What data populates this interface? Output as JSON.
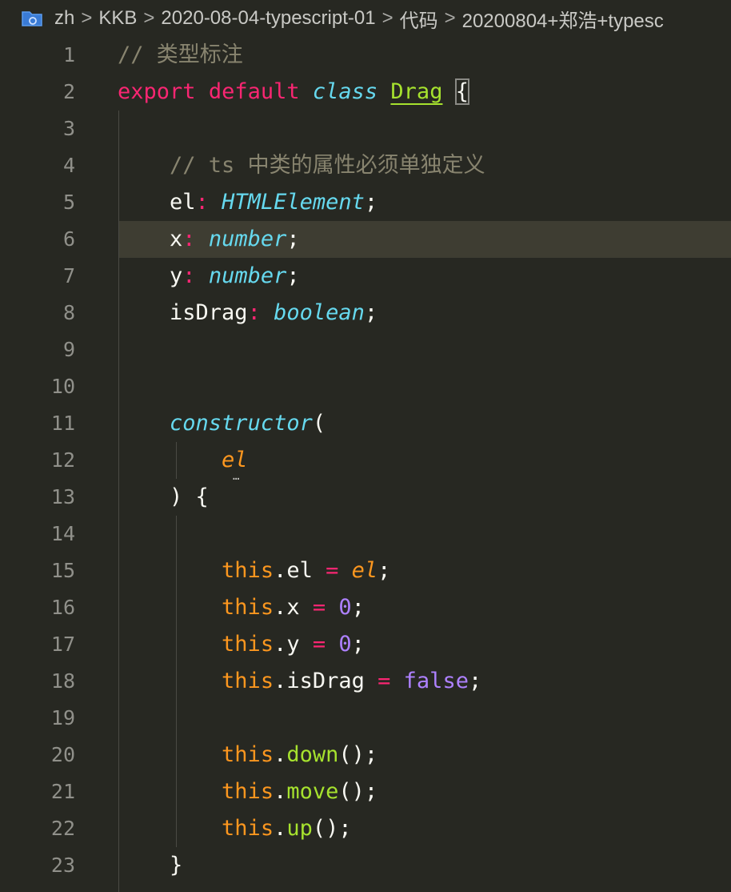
{
  "breadcrumb": {
    "segments": [
      "zh",
      "KKB",
      "2020-08-04-typescript-01",
      "代码",
      "20200804+郑浩+typesc"
    ],
    "separator": ">"
  },
  "colors": {
    "background": "#272822",
    "current_line": "#3e3d32",
    "line_number": "#90908a",
    "comment": "#88846f",
    "keyword": "#f92672",
    "type": "#66d9ef",
    "this": "#fd971f",
    "number": "#ae81ff",
    "function": "#a6e22e"
  },
  "editor": {
    "current_line_number": 6,
    "lines": [
      {
        "n": "1",
        "tokens": [
          {
            "t": "// 类型标注",
            "c": "comment"
          }
        ]
      },
      {
        "n": "2",
        "tokens": [
          {
            "t": "export",
            "c": "kw"
          },
          {
            "t": " ",
            "c": "punc"
          },
          {
            "t": "default",
            "c": "kw"
          },
          {
            "t": " ",
            "c": "punc"
          },
          {
            "t": "class",
            "c": "storage"
          },
          {
            "t": " ",
            "c": "punc"
          },
          {
            "t": "Drag",
            "c": "class"
          },
          {
            "t": " ",
            "c": "punc"
          },
          {
            "t": "{",
            "c": "brace"
          }
        ]
      },
      {
        "n": "3",
        "tokens": []
      },
      {
        "n": "4",
        "tokens": [
          {
            "t": "    ",
            "c": "punc"
          },
          {
            "t": "// ts 中类的属性必须单独定义",
            "c": "comment"
          }
        ]
      },
      {
        "n": "5",
        "tokens": [
          {
            "t": "    ",
            "c": "punc"
          },
          {
            "t": "el",
            "c": "prop"
          },
          {
            "t": ":",
            "c": "op"
          },
          {
            "t": " ",
            "c": "punc"
          },
          {
            "t": "HTMLElement",
            "c": "type"
          },
          {
            "t": ";",
            "c": "punc"
          }
        ]
      },
      {
        "n": "6",
        "tokens": [
          {
            "t": "    ",
            "c": "punc"
          },
          {
            "t": "x",
            "c": "prop"
          },
          {
            "t": ":",
            "c": "op"
          },
          {
            "t": " ",
            "c": "punc"
          },
          {
            "t": "number",
            "c": "type"
          },
          {
            "t": ";",
            "c": "punc"
          }
        ]
      },
      {
        "n": "7",
        "tokens": [
          {
            "t": "    ",
            "c": "punc"
          },
          {
            "t": "y",
            "c": "prop"
          },
          {
            "t": ":",
            "c": "op"
          },
          {
            "t": " ",
            "c": "punc"
          },
          {
            "t": "number",
            "c": "type"
          },
          {
            "t": ";",
            "c": "punc"
          }
        ]
      },
      {
        "n": "8",
        "tokens": [
          {
            "t": "    ",
            "c": "punc"
          },
          {
            "t": "isDrag",
            "c": "prop"
          },
          {
            "t": ":",
            "c": "op"
          },
          {
            "t": " ",
            "c": "punc"
          },
          {
            "t": "boolean",
            "c": "type"
          },
          {
            "t": ";",
            "c": "punc"
          }
        ]
      },
      {
        "n": "9",
        "tokens": []
      },
      {
        "n": "10",
        "tokens": []
      },
      {
        "n": "11",
        "tokens": [
          {
            "t": "    ",
            "c": "punc"
          },
          {
            "t": "constructor",
            "c": "ctor"
          },
          {
            "t": "(",
            "c": "punc"
          }
        ]
      },
      {
        "n": "12",
        "tokens": [
          {
            "t": "        ",
            "c": "punc"
          },
          {
            "t": "el",
            "c": "param"
          }
        ]
      },
      {
        "n": "13",
        "tokens": [
          {
            "t": "    ",
            "c": "punc"
          },
          {
            "t": ") {",
            "c": "punc"
          }
        ]
      },
      {
        "n": "14",
        "tokens": []
      },
      {
        "n": "15",
        "tokens": [
          {
            "t": "        ",
            "c": "punc"
          },
          {
            "t": "this",
            "c": "this"
          },
          {
            "t": ".el",
            "c": "prop"
          },
          {
            "t": " ",
            "c": "punc"
          },
          {
            "t": "=",
            "c": "op"
          },
          {
            "t": " ",
            "c": "punc"
          },
          {
            "t": "el",
            "c": "param"
          },
          {
            "t": ";",
            "c": "punc"
          }
        ]
      },
      {
        "n": "16",
        "tokens": [
          {
            "t": "        ",
            "c": "punc"
          },
          {
            "t": "this",
            "c": "this"
          },
          {
            "t": ".x",
            "c": "prop"
          },
          {
            "t": " ",
            "c": "punc"
          },
          {
            "t": "=",
            "c": "op"
          },
          {
            "t": " ",
            "c": "punc"
          },
          {
            "t": "0",
            "c": "num"
          },
          {
            "t": ";",
            "c": "punc"
          }
        ]
      },
      {
        "n": "17",
        "tokens": [
          {
            "t": "        ",
            "c": "punc"
          },
          {
            "t": "this",
            "c": "this"
          },
          {
            "t": ".y",
            "c": "prop"
          },
          {
            "t": " ",
            "c": "punc"
          },
          {
            "t": "=",
            "c": "op"
          },
          {
            "t": " ",
            "c": "punc"
          },
          {
            "t": "0",
            "c": "num"
          },
          {
            "t": ";",
            "c": "punc"
          }
        ]
      },
      {
        "n": "18",
        "tokens": [
          {
            "t": "        ",
            "c": "punc"
          },
          {
            "t": "this",
            "c": "this"
          },
          {
            "t": ".isDrag",
            "c": "prop"
          },
          {
            "t": " ",
            "c": "punc"
          },
          {
            "t": "=",
            "c": "op"
          },
          {
            "t": " ",
            "c": "punc"
          },
          {
            "t": "false",
            "c": "num"
          },
          {
            "t": ";",
            "c": "punc"
          }
        ]
      },
      {
        "n": "19",
        "tokens": []
      },
      {
        "n": "20",
        "tokens": [
          {
            "t": "        ",
            "c": "punc"
          },
          {
            "t": "this",
            "c": "this"
          },
          {
            "t": ".",
            "c": "punc"
          },
          {
            "t": "down",
            "c": "fn"
          },
          {
            "t": "();",
            "c": "punc"
          }
        ]
      },
      {
        "n": "21",
        "tokens": [
          {
            "t": "        ",
            "c": "punc"
          },
          {
            "t": "this",
            "c": "this"
          },
          {
            "t": ".",
            "c": "punc"
          },
          {
            "t": "move",
            "c": "fn"
          },
          {
            "t": "();",
            "c": "punc"
          }
        ]
      },
      {
        "n": "22",
        "tokens": [
          {
            "t": "        ",
            "c": "punc"
          },
          {
            "t": "this",
            "c": "this"
          },
          {
            "t": ".",
            "c": "punc"
          },
          {
            "t": "up",
            "c": "fn"
          },
          {
            "t": "();",
            "c": "punc"
          }
        ]
      },
      {
        "n": "23",
        "tokens": [
          {
            "t": "    ",
            "c": "punc"
          },
          {
            "t": "}",
            "c": "punc"
          }
        ]
      }
    ]
  }
}
